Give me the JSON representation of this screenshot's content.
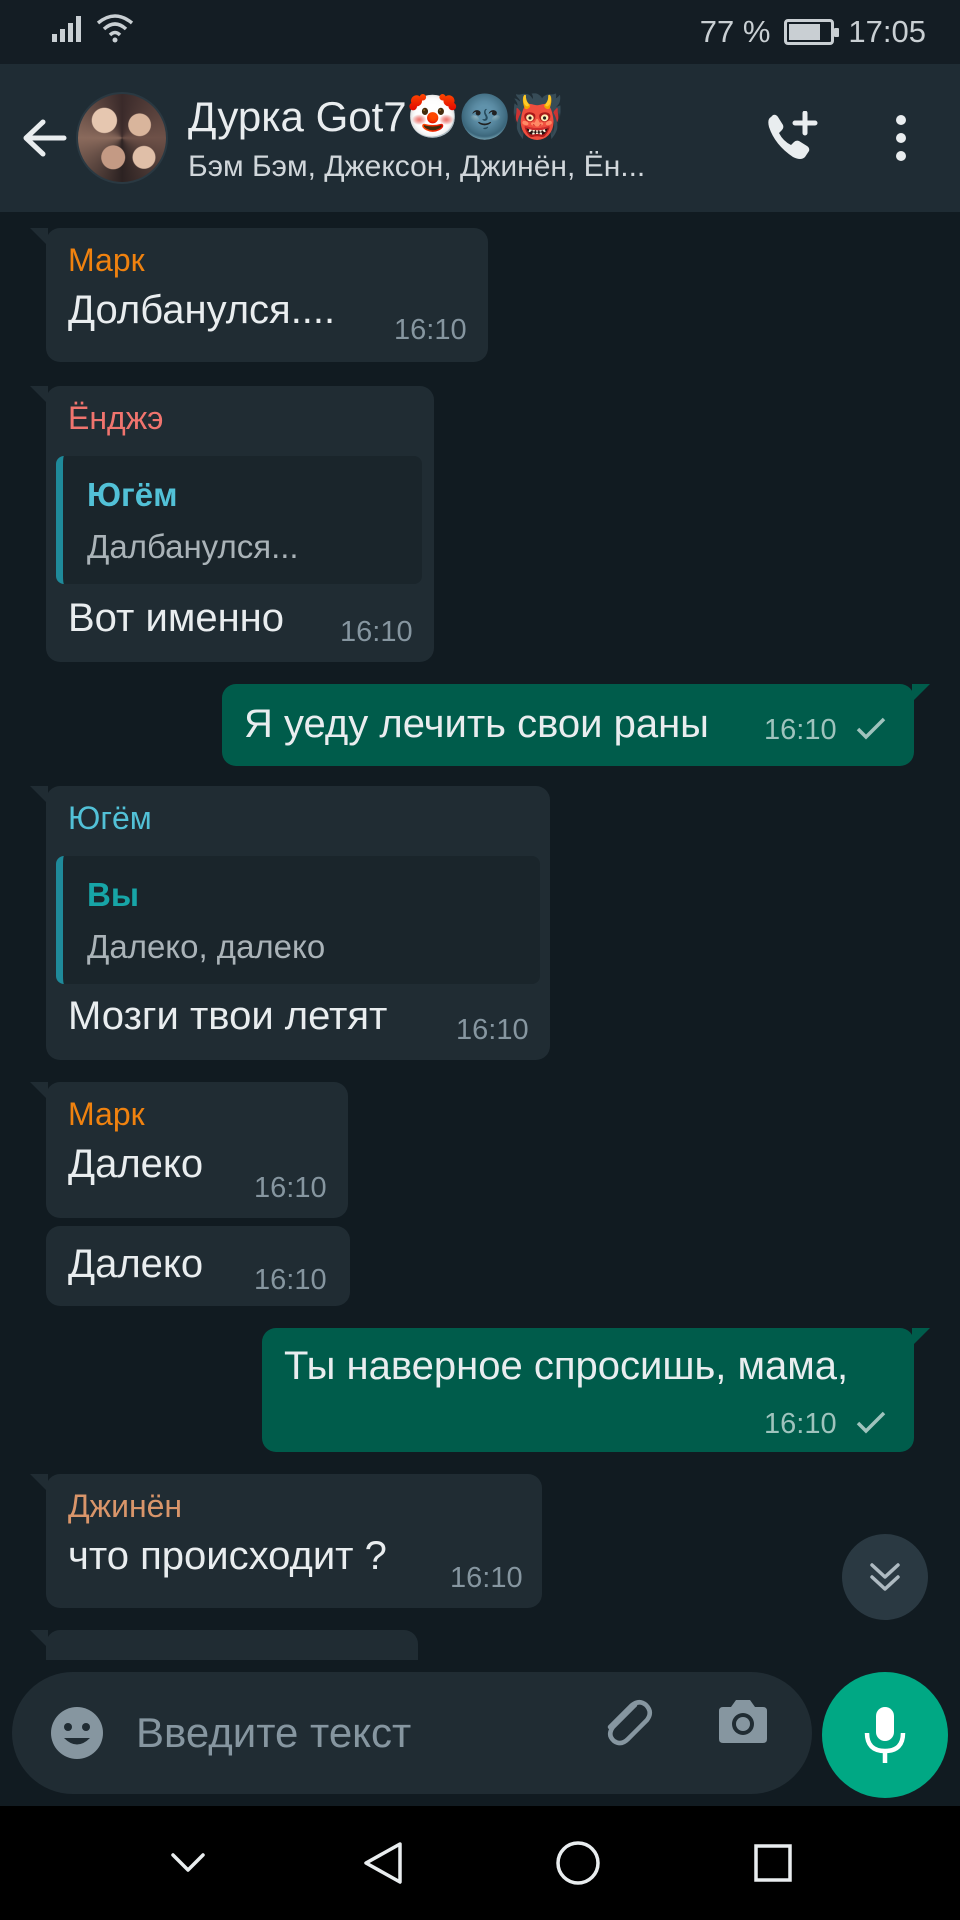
{
  "status_bar": {
    "battery_text": "77 %",
    "time": "17:05",
    "battery_level": 0.77
  },
  "header": {
    "title": "Дурка Got7🤡🌚👹",
    "subtitle": "Бэм Бэм, Джексон, Джинён, Ён..."
  },
  "colors": {
    "mark": "#f0820f",
    "yongjae": "#f0746e",
    "yugyeom": "#52c1d7",
    "you_quote": "#17a5a7",
    "jinyoung": "#d9956a",
    "outgoing_bubble": "#005c4b",
    "incoming_bubble": "#202c33",
    "accent": "#00a884"
  },
  "messages": [
    {
      "sender": "Марк",
      "text": "Долбанулся....",
      "time": "16:10"
    },
    {
      "sender": "Ёнджэ",
      "quote_name": "Югём",
      "quote_text": "Далбанулся...",
      "text": "Вот именно",
      "time": "16:10"
    },
    {
      "text": "Я уеду лечить свои раны",
      "time": "16:10"
    },
    {
      "sender": "Югём",
      "quote_name": "Вы",
      "quote_text": "Далеко, далеко",
      "text": "Мозги твои летят",
      "time": "16:10"
    },
    {
      "sender": "Марк",
      "text": "Далеко",
      "time": "16:10"
    },
    {
      "text": "Далеко",
      "time": "16:10"
    },
    {
      "text": "Ты наверное спросишь, мама,",
      "time": "16:10"
    },
    {
      "sender": "Джинён",
      "text": "что происходит ?",
      "time": "16:10"
    }
  ],
  "input": {
    "placeholder": "Введите текст"
  },
  "icons": {
    "back": "arrow-left",
    "add_call": "phone-plus",
    "menu": "three-dots-vertical",
    "emoji": "smiley",
    "attach": "paperclip",
    "camera": "camera",
    "mic": "microphone",
    "scroll_down": "double-chevron-down",
    "nav": [
      "chevron-down",
      "back-triangle",
      "home-circle",
      "recents-square"
    ]
  }
}
